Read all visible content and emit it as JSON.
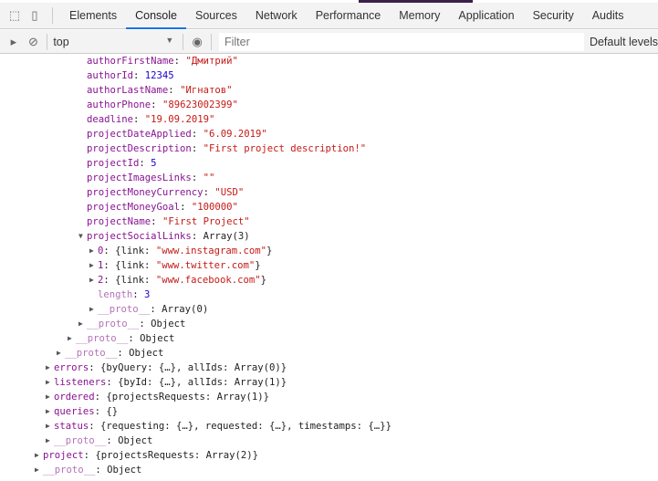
{
  "tabs": [
    "Elements",
    "Console",
    "Sources",
    "Network",
    "Performance",
    "Memory",
    "Application",
    "Security",
    "Audits"
  ],
  "active_tab": "Console",
  "toolbar": {
    "context": "top",
    "filter_placeholder": "Filter",
    "levels": "Default levels"
  },
  "rows": [
    {
      "l": 4,
      "a": "",
      "k": "authorFirstName",
      "v": "\"Дмитрий\"",
      "t": "s"
    },
    {
      "l": 4,
      "a": "",
      "k": "authorId",
      "v": "12345",
      "t": "n"
    },
    {
      "l": 4,
      "a": "",
      "k": "authorLastName",
      "v": "\"Игнатов\"",
      "t": "s"
    },
    {
      "l": 4,
      "a": "",
      "k": "authorPhone",
      "v": "\"89623002399\"",
      "t": "s"
    },
    {
      "l": 4,
      "a": "",
      "k": "deadline",
      "v": "\"19.09.2019\"",
      "t": "s"
    },
    {
      "l": 4,
      "a": "",
      "k": "projectDateApplied",
      "v": "\"6.09.2019\"",
      "t": "s"
    },
    {
      "l": 4,
      "a": "",
      "k": "projectDescription",
      "v": "\"First project description!\"",
      "t": "s"
    },
    {
      "l": 4,
      "a": "",
      "k": "projectId",
      "v": "5",
      "t": "n"
    },
    {
      "l": 4,
      "a": "",
      "k": "projectImagesLinks",
      "v": "\"\"",
      "t": "s"
    },
    {
      "l": 4,
      "a": "",
      "k": "projectMoneyCurrency",
      "v": "\"USD\"",
      "t": "s"
    },
    {
      "l": 4,
      "a": "",
      "k": "projectMoneyGoal",
      "v": "\"100000\"",
      "t": "s"
    },
    {
      "l": 4,
      "a": "",
      "k": "projectName",
      "v": "\"First Project\"",
      "t": "s"
    },
    {
      "l": 4,
      "a": "down",
      "k": "projectSocialLinks",
      "v": "Array(3)",
      "t": "p"
    },
    {
      "l": 5,
      "a": "right",
      "k": "0",
      "v": "{link: ",
      "v2": "\"www.instagram.com\"",
      "v3": "}",
      "t": "p"
    },
    {
      "l": 5,
      "a": "right",
      "k": "1",
      "v": "{link: ",
      "v2": "\"www.twitter.com\"",
      "v3": "}",
      "t": "p"
    },
    {
      "l": 5,
      "a": "right",
      "k": "2",
      "v": "{link: ",
      "v2": "\"www.facebook.com\"",
      "v3": "}",
      "t": "p"
    },
    {
      "l": 5,
      "a": "",
      "k": "length",
      "v": "3",
      "t": "n",
      "dim": true
    },
    {
      "l": 5,
      "a": "right",
      "k": "__proto__",
      "v": "Array(0)",
      "t": "p",
      "dim": true
    },
    {
      "l": 4,
      "a": "right",
      "k": "__proto__",
      "v": "Object",
      "t": "p",
      "dim": true
    },
    {
      "l": 3,
      "a": "right",
      "k": "__proto__",
      "v": "Object",
      "t": "p",
      "dim": true
    },
    {
      "l": 2,
      "a": "right",
      "k": "__proto__",
      "v": "Object",
      "t": "p",
      "dim": true
    },
    {
      "l": 1,
      "a": "right",
      "k": "errors",
      "v": "{byQuery: {…}, allIds: Array(0)}",
      "t": "p"
    },
    {
      "l": 1,
      "a": "right",
      "k": "listeners",
      "v": "{byId: {…}, allIds: Array(1)}",
      "t": "p"
    },
    {
      "l": 1,
      "a": "right",
      "k": "ordered",
      "v": "{projectsRequests: Array(1)}",
      "t": "p"
    },
    {
      "l": 1,
      "a": "right",
      "k": "queries",
      "v": "{}",
      "t": "p"
    },
    {
      "l": 1,
      "a": "right",
      "k": "status",
      "v": "{requesting: {…}, requested: {…}, timestamps: {…}}",
      "t": "p"
    },
    {
      "l": 1,
      "a": "right",
      "k": "__proto__",
      "v": "Object",
      "t": "p",
      "dim": true
    },
    {
      "l": 0,
      "a": "right",
      "k": "project",
      "v": "{projectsRequests: Array(2)}",
      "t": "p"
    },
    {
      "l": 0,
      "a": "right",
      "k": "__proto__",
      "v": "Object",
      "t": "p",
      "dim": true
    }
  ]
}
